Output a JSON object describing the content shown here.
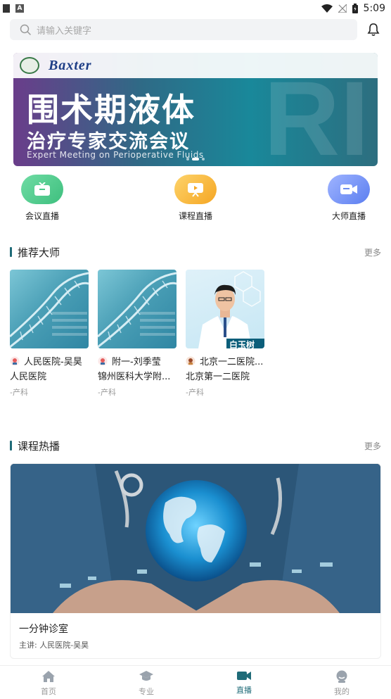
{
  "status_bar": {
    "time": "5:09"
  },
  "search": {
    "placeholder": "请输入关键字"
  },
  "banner": {
    "brand": "Baxter",
    "title_line1": "围术期液体",
    "title_line2": "治疗专家交流会议",
    "subtitle_en": "Expert Meeting on Perioperative Fluids",
    "ghost_text": "RI"
  },
  "quick_actions": [
    {
      "label": "会议直播",
      "icon": "tv-icon",
      "color": "#4cc98a"
    },
    {
      "label": "课程直播",
      "icon": "presentation-icon",
      "color": "#f7b731"
    },
    {
      "label": "大师直播",
      "icon": "video-camera-icon",
      "color": "#6d8cf0"
    }
  ],
  "recommended_masters": {
    "title": "推荐大师",
    "more": "更多",
    "items": [
      {
        "name": "人民医院-吴昊",
        "hospital": "人民医院",
        "dept": "-产科",
        "image": "dna"
      },
      {
        "name": "附一-刘季莹",
        "hospital": "锦州医科大学附...",
        "dept": "-产科",
        "image": "dna"
      },
      {
        "name": "北京一二医院...",
        "hospital": "北京第一二医院",
        "dept": "-产科",
        "image": "doctor",
        "photo_caption": "白玉树"
      }
    ]
  },
  "hot_courses": {
    "title": "课程热播",
    "more": "更多",
    "items": [
      {
        "title": "一分钟诊室",
        "speaker": "主讲: 人民医院-吴昊"
      }
    ]
  },
  "tab_bar": {
    "active": "直播",
    "accent": "#1f6b78",
    "items": [
      {
        "label": "首页",
        "icon": "home-icon"
      },
      {
        "label": "专业",
        "icon": "graduation-cap-icon"
      },
      {
        "label": "直播",
        "icon": "video-camera-icon"
      },
      {
        "label": "我的",
        "icon": "user-icon"
      }
    ]
  }
}
